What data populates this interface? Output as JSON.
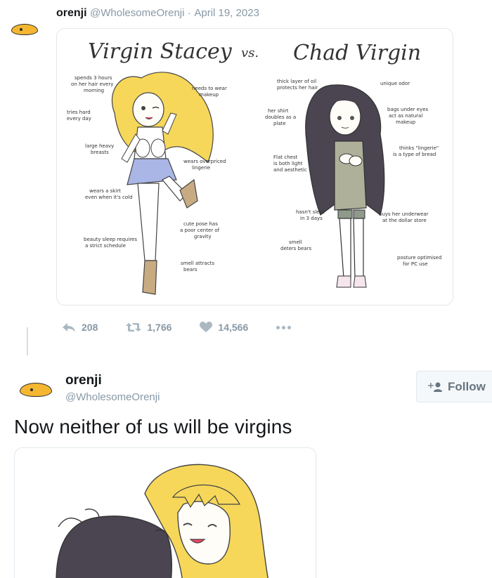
{
  "quoted_tweet": {
    "name": "orenji",
    "handle": "@WholesomeOrenji",
    "separator": "·",
    "date": "April 19, 2023",
    "comic": {
      "title_left": "Virgin Stacey",
      "vs": "vs.",
      "title_right": "Chad Virgin",
      "left_notes": [
        "spends 3 hours",
        "on her hair every",
        "morning",
        "needs to wear",
        "makeup",
        "tries hard",
        "every day",
        "large heavy",
        "breasts",
        "wears overpriced",
        "lingerie",
        "wears a skirt",
        "even when it's cold",
        "cute pose has",
        "a poor center of",
        "gravity",
        "beauty sleep requires",
        "a strict schedule",
        "smell attracts",
        "bears"
      ],
      "right_notes": [
        "thick layer of oil",
        "protects her hair",
        "unique odor",
        "her shirt",
        "doubles as a",
        "plate",
        "bags under eyes",
        "act as natural",
        "makeup",
        "Flat chest",
        "is both light",
        "and aesthetic",
        "thinks \"lingerie\"",
        "is a type of bread",
        "hasn't slept",
        "in 3 days",
        "buys her underwear",
        "at the dollar store",
        "smell",
        "deters bears",
        "posture optimised",
        "for PC use"
      ]
    },
    "actions": {
      "reply_count": "208",
      "retweet_count": "1,766",
      "like_count": "14,566"
    }
  },
  "tweet": {
    "name": "orenji",
    "handle": "@WholesomeOrenji",
    "follow_label": "Follow",
    "text": "Now neither of us will be virgins"
  },
  "icons": {
    "reply": "reply-icon",
    "retweet": "retweet-icon",
    "like": "heart-icon",
    "more": "more-dots-icon",
    "follow": "add-user-icon",
    "avatar": "orange-blob-avatar"
  },
  "colors": {
    "text": "#14171a",
    "muted": "#8899a6",
    "border": "#e1e8ed",
    "avatar_orange": "#f5b731",
    "hair_blonde": "#f6d75a",
    "hair_dark": "#4a4550",
    "skirt": "#a9b6e6",
    "shirt": "#aeb09a"
  }
}
